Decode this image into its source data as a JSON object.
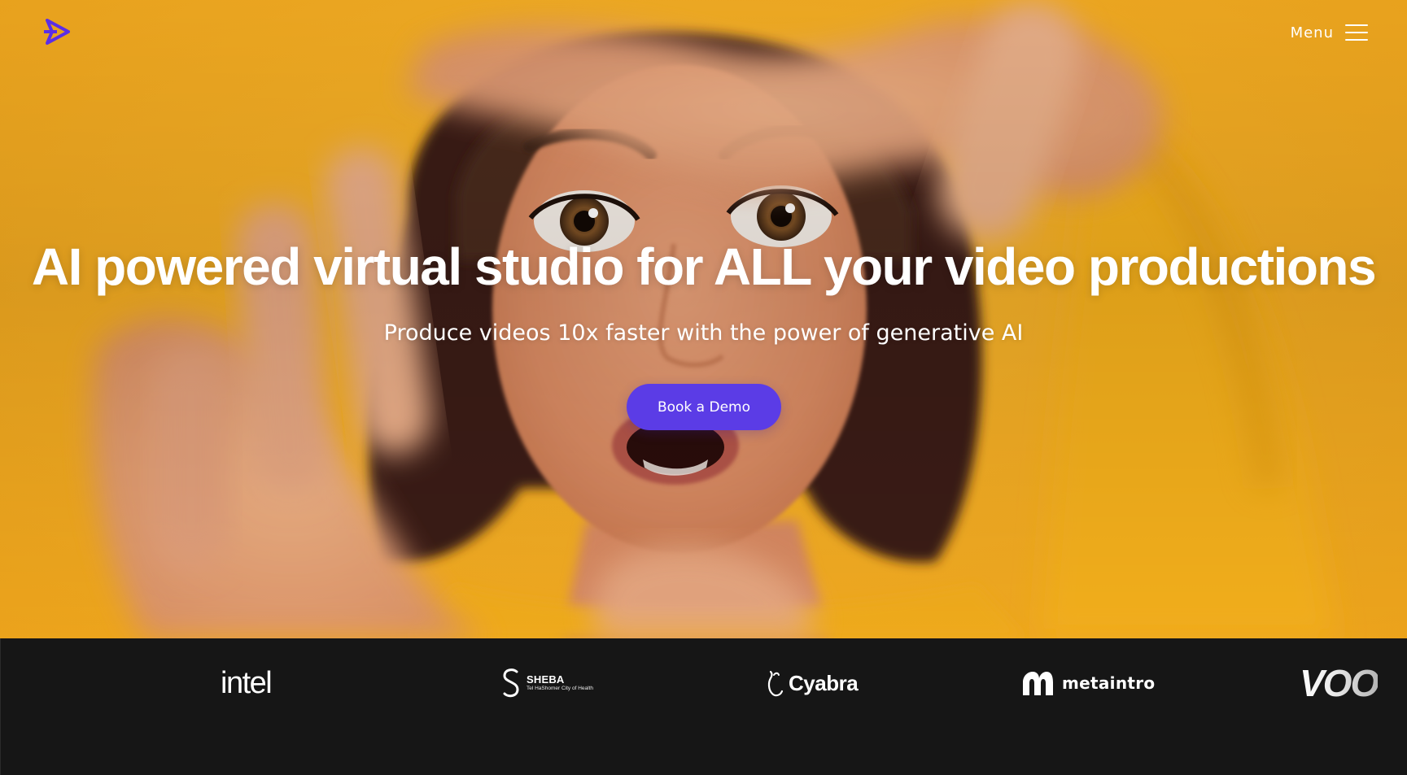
{
  "header": {
    "logo_icon": "play-arrow-logo-icon",
    "menu_label": "Menu",
    "menu_icon": "hamburger-icon"
  },
  "hero": {
    "background_image": "woman-framing-hands-photo",
    "headline": "AI powered virtual studio for ALL your video productions",
    "subheadline": "Produce videos 10x faster with the power of generative AI",
    "cta_label": "Book a Demo"
  },
  "clients": [
    {
      "name": "intel",
      "text": "intel"
    },
    {
      "name": "sheba",
      "text": "SHEBA",
      "subtext": "Tel HaShomer City of Health"
    },
    {
      "name": "cyabra",
      "text": "Cyabra"
    },
    {
      "name": "metaintro",
      "text": "metaintro"
    },
    {
      "name": "voo",
      "text": "VOO"
    }
  ],
  "colors": {
    "brand": "#5b3ce6",
    "hero_background": "#f5ae24",
    "strip_background": "#161616",
    "text": "#ffffff"
  }
}
